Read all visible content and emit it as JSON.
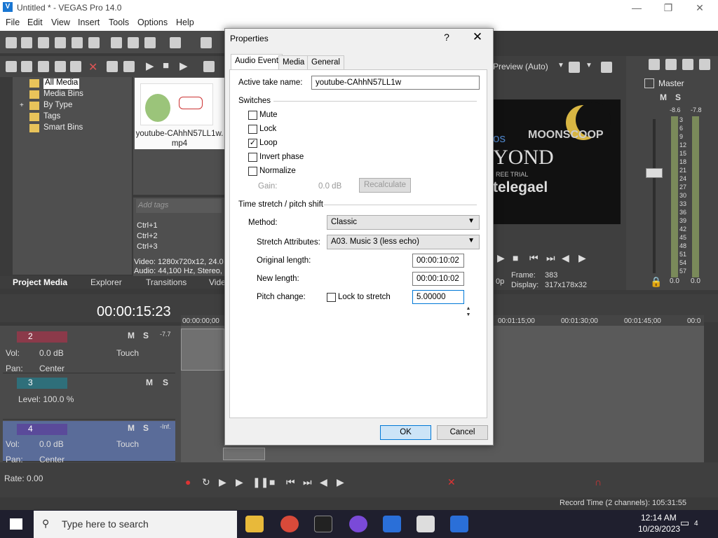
{
  "window": {
    "title": "Untitled * - VEGAS Pro 14.0",
    "logo": "V"
  },
  "menu": [
    "File",
    "Edit",
    "View",
    "Insert",
    "Tools",
    "Options",
    "Help"
  ],
  "explorer": {
    "tree": [
      "All Media",
      "Media Bins",
      "By Type",
      "Tags",
      "Smart Bins"
    ],
    "thumb_caption": "youtube-CAhhN57LL1w.\nmp4",
    "add_tags_placeholder": "Add tags",
    "shortcuts": [
      "Ctrl+1",
      "Ctrl+2",
      "Ctrl+3"
    ],
    "info1": "Video: 1280x720x12, 24.0",
    "info2": "Audio: 44,100 Hz, Stereo,",
    "tabs": [
      "Project Media",
      "Explorer",
      "Transitions",
      "Vide"
    ]
  },
  "preview": {
    "mode": "Preview (Auto)",
    "frame_label": "Frame:",
    "frame_value": "383",
    "display_label": "Display:",
    "display_value": "317x178x32",
    "res": "0p",
    "video_text1": "MOONSCOOP",
    "video_text2": "os",
    "video_text3": "YOND",
    "video_text4": "REE TRIAL",
    "video_text5": "telegael"
  },
  "master": {
    "title": "Master",
    "left_peak": "-8.6",
    "right_peak": "-7.8",
    "scale": [
      "3",
      "6",
      "9",
      "12",
      "15",
      "18",
      "21",
      "24",
      "27",
      "30",
      "33",
      "36",
      "39",
      "42",
      "45",
      "48",
      "51",
      "54",
      "57"
    ],
    "left_val": "0.0",
    "right_val": "0.0"
  },
  "timeline": {
    "timecode": "00:00:15:23",
    "ruler": [
      "00:00:00;00",
      "00:01:15;00",
      "00:01:30;00",
      "00:01:45;00",
      "00:0"
    ],
    "rate": "Rate: 0.00"
  },
  "tracks": [
    {
      "num": "2",
      "vol_label": "Vol:",
      "vol": "0.0 dB",
      "pan_label": "Pan:",
      "pan": "Center",
      "touch": "Touch",
      "peak": "-7.7"
    },
    {
      "num": "3",
      "level": "Level: 100.0 %"
    },
    {
      "num": "4",
      "vol_label": "Vol:",
      "vol": "0.0 dB",
      "pan_label": "Pan:",
      "pan": "Center",
      "touch": "Touch",
      "peak": "-Inf."
    }
  ],
  "meter_marks": [
    "12",
    "24",
    "36",
    "48"
  ],
  "status": {
    "record": "Record Time (2 channels): 105:31:55"
  },
  "taskbar": {
    "search": "Type here to search",
    "time": "12:14 AM",
    "date": "10/29/2023",
    "notif": "4"
  },
  "dialog": {
    "title": "Properties",
    "help": "?",
    "close": "✕",
    "tabs": [
      "Audio Event",
      "Media",
      "General"
    ],
    "take_label": "Active take name:",
    "take_value": "youtube-CAhhN57LL1w",
    "switches_label": "Switches",
    "switches": [
      {
        "label": "Mute",
        "checked": false
      },
      {
        "label": "Lock",
        "checked": false
      },
      {
        "label": "Loop",
        "checked": true
      },
      {
        "label": "Invert phase",
        "checked": false
      },
      {
        "label": "Normalize",
        "checked": false
      }
    ],
    "gain_label": "Gain:",
    "gain_value": "0.0 dB",
    "recalc": "Recalculate",
    "stretch_label": "Time stretch / pitch shift",
    "method_label": "Method:",
    "method_value": "Classic",
    "attr_label": "Stretch Attributes:",
    "attr_value": "A03. Music 3 (less echo)",
    "orig_label": "Original length:",
    "orig_value": "00:00:10:02",
    "new_label": "New length:",
    "new_value": "00:00:10:02",
    "pitch_label": "Pitch change:",
    "lock_label": "Lock to stretch",
    "pitch_value": "5.00000",
    "ok": "OK",
    "cancel": "Cancel"
  }
}
